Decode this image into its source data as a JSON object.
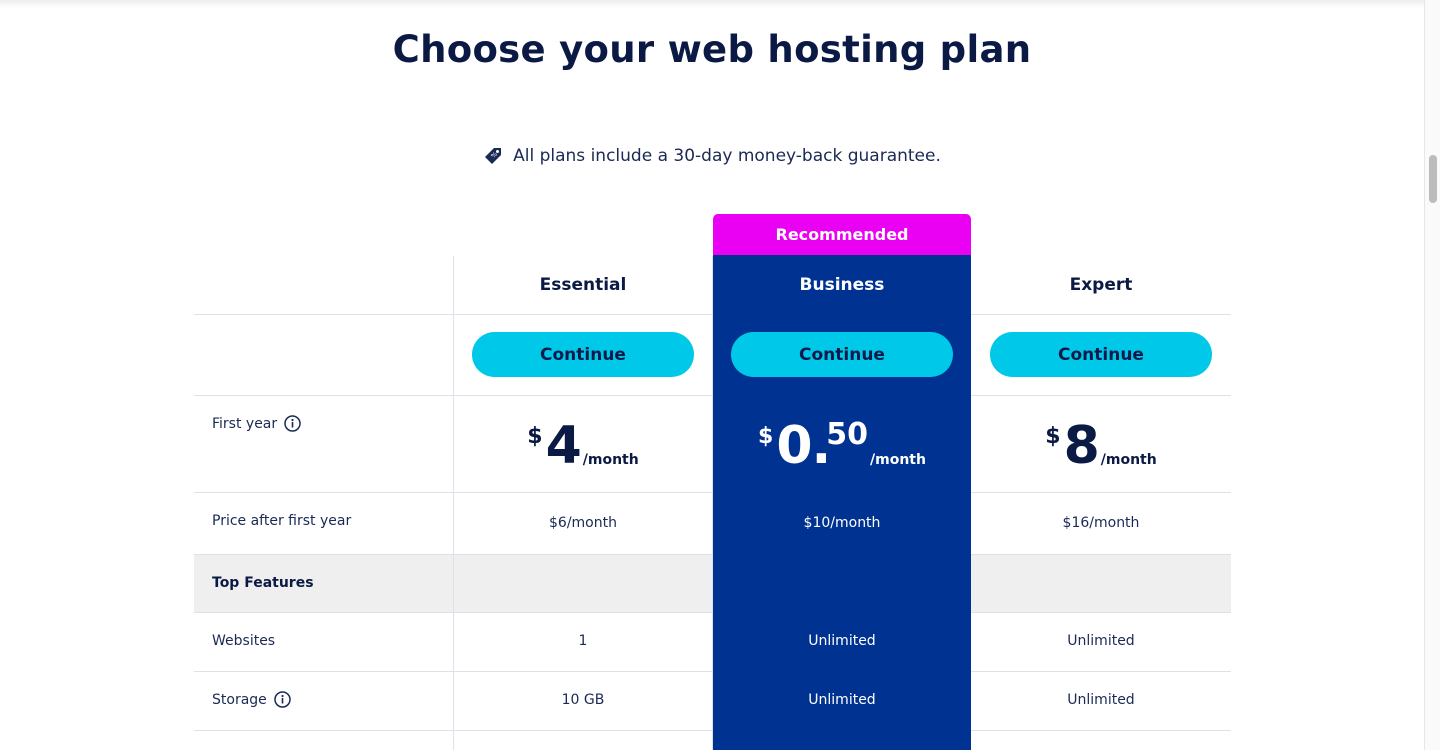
{
  "header": {
    "title": "Choose your web hosting plan",
    "guarantee": "All plans include a 30-day money-back guarantee.",
    "guarantee_icon": "price-tag-icon"
  },
  "colors": {
    "brand_dark": "#0b1a45",
    "recommended_badge": "#ea00f2",
    "business_column": "#003391",
    "button": "#00c8e8",
    "feature_row_bg": "#efefef"
  },
  "plans": [
    {
      "name": "Essential",
      "button": "Continue",
      "price_currency": "$",
      "price_amount": "4",
      "price_cents": "",
      "price_period": "/month",
      "price_after_first_year": "$6/month",
      "websites": "1",
      "storage": "10 GB",
      "recommended": false
    },
    {
      "name": "Business",
      "badge": "Recommended",
      "button": "Continue",
      "price_currency": "$",
      "price_amount": "0.",
      "price_cents": "50",
      "price_period": "/month",
      "price_after_first_year": "$10/month",
      "websites": "Unlimited",
      "storage": "Unlimited",
      "recommended": true
    },
    {
      "name": "Expert",
      "button": "Continue",
      "price_currency": "$",
      "price_amount": "8",
      "price_cents": "",
      "price_period": "/month",
      "price_after_first_year": "$16/month",
      "websites": "Unlimited",
      "storage": "Unlimited",
      "recommended": false
    }
  ],
  "rows": {
    "first_year": "First year",
    "price_after": "Price after first year",
    "top_features": "Top Features",
    "websites": "Websites",
    "storage": "Storage"
  }
}
